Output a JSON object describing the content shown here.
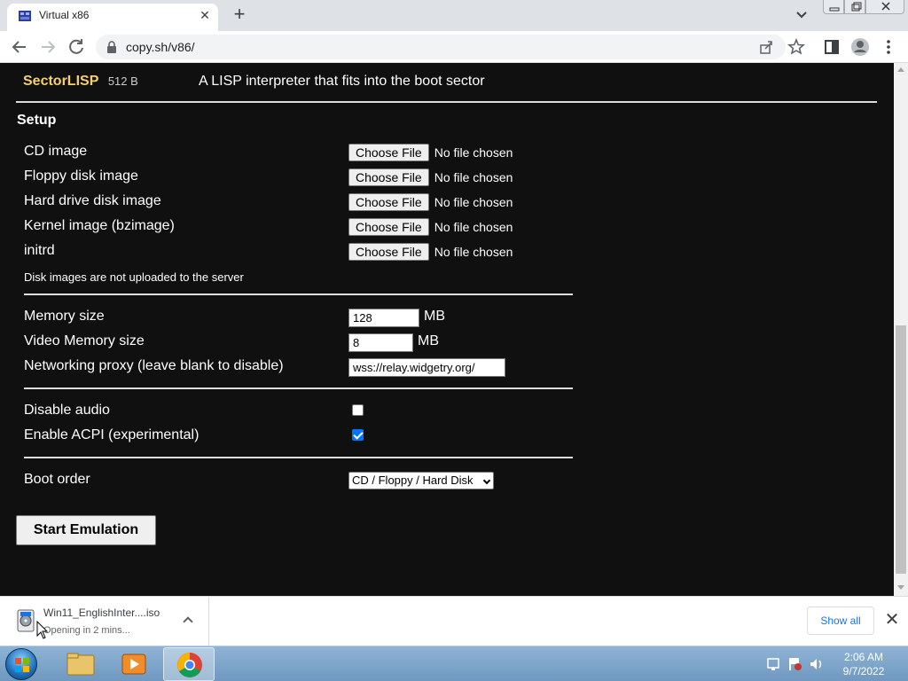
{
  "browser": {
    "tab_title": "Virtual x86",
    "url": "copy.sh/v86/"
  },
  "os_list": [
    {
      "name": "SectorLISP",
      "size": "512 B",
      "desc": "A LISP interpreter that fits into the boot sector"
    }
  ],
  "setup": {
    "title": "Setup",
    "files": [
      {
        "label": "CD image",
        "button": "Choose File",
        "status": "No file chosen"
      },
      {
        "label": "Floppy disk image",
        "button": "Choose File",
        "status": "No file chosen"
      },
      {
        "label": "Hard drive disk image",
        "button": "Choose File",
        "status": "No file chosen"
      },
      {
        "label": "Kernel image (bzimage)",
        "button": "Choose File",
        "status": "No file chosen"
      },
      {
        "label": "initrd",
        "button": "Choose File",
        "status": "No file chosen"
      }
    ],
    "upload_note": "Disk images are not uploaded to the server",
    "memory": {
      "label": "Memory size",
      "value": "128",
      "unit": "MB"
    },
    "video_memory": {
      "label": "Video Memory size",
      "value": "8",
      "unit": "MB"
    },
    "proxy": {
      "label": "Networking proxy (leave blank to disable)",
      "value": "wss://relay.widgetry.org/"
    },
    "disable_audio": {
      "label": "Disable audio",
      "checked": false
    },
    "enable_acpi": {
      "label": "Enable ACPI (experimental)",
      "checked": true
    },
    "boot_order": {
      "label": "Boot order",
      "value": "CD / Floppy / Hard Disk"
    },
    "start_label": "Start Emulation"
  },
  "downloads": {
    "file_name": "Win11_EnglishInter....iso",
    "status": "Opening in 2 mins...",
    "show_all": "Show all"
  },
  "taskbar": {
    "time": "2:06 AM",
    "date": "9/7/2022"
  },
  "colors": {
    "page_bg": "#101010",
    "os_name": "#f5d06a",
    "checkbox_on": "#0075ff",
    "link_blue": "#1a73e8"
  }
}
